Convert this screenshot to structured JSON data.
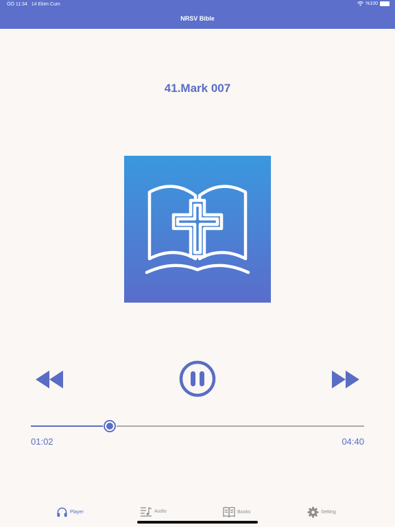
{
  "status": {
    "time": "ÖÖ 11:34",
    "date": "14 Ekim Cum",
    "battery": "%100"
  },
  "header": {
    "title": "NRSV Bible"
  },
  "player": {
    "track_title": "41.Mark 007",
    "cover_icon": "open-bible-cross-icon",
    "state": "playing",
    "progress": 0.2366,
    "elapsed": "01:02",
    "duration": "04:40"
  },
  "tabs": [
    {
      "label": "Player",
      "icon": "headphones-icon",
      "active": true
    },
    {
      "label": "Audio",
      "icon": "audio-list-icon",
      "active": false
    },
    {
      "label": "Books",
      "icon": "book-icon",
      "active": false
    },
    {
      "label": "Setting",
      "icon": "gear-icon",
      "active": false
    }
  ],
  "colors": {
    "accent": "#5a6dc4",
    "header": "#5b6fcb",
    "background": "#faf7f4",
    "cover_top": "#3a98de",
    "cover_bottom": "#5a6dcb"
  }
}
